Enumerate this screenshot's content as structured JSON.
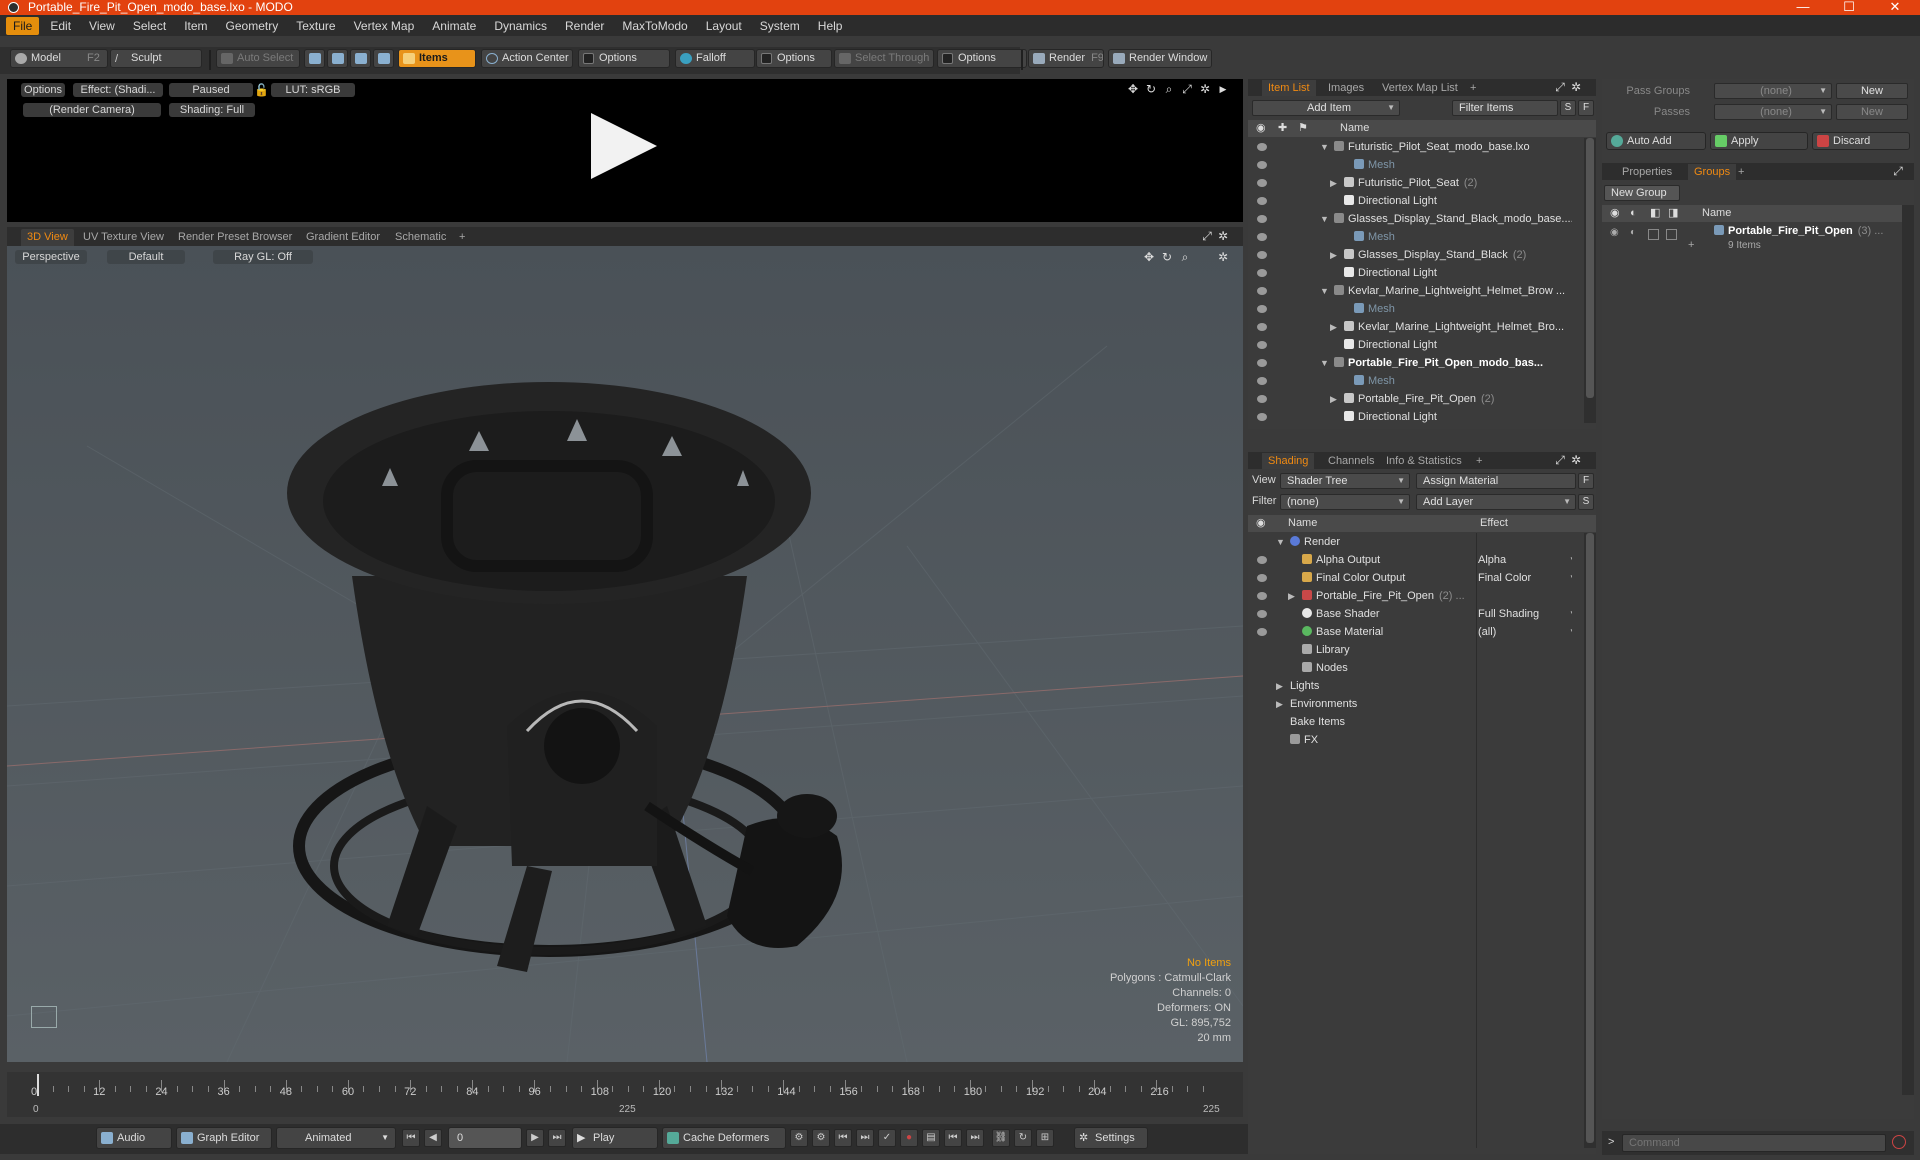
{
  "window": {
    "title": "Portable_Fire_Pit_Open_modo_base.lxo - MODO",
    "minimize": "—",
    "maximize": "☐",
    "close": "✕"
  },
  "menu": [
    "File",
    "Edit",
    "View",
    "Select",
    "Item",
    "Geometry",
    "Texture",
    "Vertex Map",
    "Animate",
    "Dynamics",
    "Render",
    "MaxToModo",
    "Layout",
    "System",
    "Help"
  ],
  "toolbar": {
    "model": "Model",
    "model_key": "F2",
    "sculpt": "Sculpt",
    "auto_select": "Auto Select",
    "items": "Items",
    "action_center": "Action Center",
    "options1": "Options",
    "falloff": "Falloff",
    "options2": "Options",
    "select_through": "Select Through",
    "options3": "Options",
    "render": "Render",
    "render_key": "F9",
    "render_window": "Render Window"
  },
  "preview": {
    "options": "Options",
    "effect": "Effect: (Shadi...",
    "paused": "Paused",
    "lut": "LUT: sRGB",
    "camera": "(Render Camera)",
    "shading": "Shading: Full"
  },
  "viewport_tabs": [
    "3D View",
    "UV Texture View",
    "Render Preset Browser",
    "Gradient Editor",
    "Schematic",
    "+"
  ],
  "viewport": {
    "perspective": "Perspective",
    "default": "Default",
    "raygl": "Ray GL: Off"
  },
  "stats": {
    "no_items": "No Items",
    "polygons": "Polygons : Catmull-Clark",
    "channels": "Channels: 0",
    "deformers": "Deformers: ON",
    "gl": "GL: 895,752",
    "scale": "20 mm"
  },
  "timeline": {
    "ticks": [
      "0",
      "12",
      "24",
      "36",
      "48",
      "60",
      "72",
      "84",
      "96",
      "108",
      "120",
      "132",
      "144",
      "156",
      "168",
      "180",
      "192",
      "204",
      "216"
    ],
    "start": "0",
    "mid": "225",
    "end": "225"
  },
  "transport": {
    "audio": "Audio",
    "graph_editor": "Graph Editor",
    "animated": "Animated",
    "frame": "0",
    "play": "Play",
    "cache_deformers": "Cache Deformers",
    "settings": "Settings"
  },
  "item_list": {
    "tabs": [
      "Item List",
      "Images",
      "Vertex Map List",
      "+"
    ],
    "add_item": "Add Item",
    "filter_items": "Filter Items",
    "s": "S",
    "f": "F",
    "col_name": "Name",
    "rows": [
      {
        "label": "Futuristic_Pilot_Seat_modo_base.lxo",
        "count": "",
        "indent": 0,
        "tri": "▼",
        "icon": "scene",
        "dim": false,
        "bold": false
      },
      {
        "label": "Mesh",
        "count": "",
        "indent": 2,
        "tri": "",
        "icon": "mesh",
        "dim": true,
        "bold": false
      },
      {
        "label": "Futuristic_Pilot_Seat",
        "count": "(2)",
        "indent": 1,
        "tri": "▶",
        "icon": "group",
        "dim": false,
        "bold": false
      },
      {
        "label": "Directional Light",
        "count": "",
        "indent": 1,
        "tri": "",
        "icon": "light",
        "dim": false,
        "bold": false
      },
      {
        "label": "Glasses_Display_Stand_Black_modo_base....",
        "count": "",
        "indent": 0,
        "tri": "▼",
        "icon": "scene",
        "dim": false,
        "bold": false
      },
      {
        "label": "Mesh",
        "count": "",
        "indent": 2,
        "tri": "",
        "icon": "mesh",
        "dim": true,
        "bold": false
      },
      {
        "label": "Glasses_Display_Stand_Black",
        "count": "(2)",
        "indent": 1,
        "tri": "▶",
        "icon": "group",
        "dim": false,
        "bold": false
      },
      {
        "label": "Directional Light",
        "count": "",
        "indent": 1,
        "tri": "",
        "icon": "light",
        "dim": false,
        "bold": false
      },
      {
        "label": "Kevlar_Marine_Lightweight_Helmet_Brow ...",
        "count": "",
        "indent": 0,
        "tri": "▼",
        "icon": "scene",
        "dim": false,
        "bold": false
      },
      {
        "label": "Mesh",
        "count": "",
        "indent": 2,
        "tri": "",
        "icon": "mesh",
        "dim": true,
        "bold": false
      },
      {
        "label": "Kevlar_Marine_Lightweight_Helmet_Bro...",
        "count": "",
        "indent": 1,
        "tri": "▶",
        "icon": "group",
        "dim": false,
        "bold": false
      },
      {
        "label": "Directional Light",
        "count": "",
        "indent": 1,
        "tri": "",
        "icon": "light",
        "dim": false,
        "bold": false
      },
      {
        "label": "Portable_Fire_Pit_Open_modo_bas...",
        "count": "",
        "indent": 0,
        "tri": "▼",
        "icon": "scene",
        "dim": false,
        "bold": true
      },
      {
        "label": "Mesh",
        "count": "",
        "indent": 2,
        "tri": "",
        "icon": "mesh",
        "dim": true,
        "bold": false
      },
      {
        "label": "Portable_Fire_Pit_Open",
        "count": "(2)",
        "indent": 1,
        "tri": "▶",
        "icon": "group",
        "dim": false,
        "bold": false
      },
      {
        "label": "Directional Light",
        "count": "",
        "indent": 1,
        "tri": "",
        "icon": "light",
        "dim": false,
        "bold": false
      }
    ]
  },
  "shading": {
    "tabs": [
      "Shading",
      "Channels",
      "Info & Statistics",
      "+"
    ],
    "view_label": "View",
    "view_value": "Shader Tree",
    "assign_material": "Assign Material",
    "filter_label": "Filter",
    "filter_value": "(none)",
    "add_layer": "Add Layer",
    "f": "F",
    "s": "S",
    "col_name": "Name",
    "col_effect": "Effect",
    "rows": [
      {
        "label": "Render",
        "effect": "",
        "indent": 0,
        "tri": "▼",
        "icon": "render",
        "eye": false
      },
      {
        "label": "Alpha Output",
        "effect": "Alpha",
        "indent": 1,
        "tri": "",
        "icon": "output",
        "eye": true
      },
      {
        "label": "Final Color Output",
        "effect": "Final Color",
        "indent": 1,
        "tri": "",
        "icon": "output",
        "eye": true
      },
      {
        "label": "Portable_Fire_Pit_Open",
        "count": "(2) ...",
        "effect": "",
        "indent": 1,
        "tri": "▶",
        "icon": "matgroup",
        "eye": true
      },
      {
        "label": "Base Shader",
        "effect": "Full Shading",
        "indent": 1,
        "tri": "",
        "icon": "shader",
        "eye": true
      },
      {
        "label": "Base Material",
        "effect": "(all)",
        "indent": 1,
        "tri": "",
        "icon": "material",
        "eye": true
      },
      {
        "label": "Library",
        "effect": "",
        "indent": 1,
        "tri": "",
        "icon": "folder",
        "eye": false
      },
      {
        "label": "Nodes",
        "effect": "",
        "indent": 1,
        "tri": "",
        "icon": "folder",
        "eye": false
      },
      {
        "label": "Lights",
        "effect": "",
        "indent": 0,
        "tri": "▶",
        "icon": "",
        "eye": false
      },
      {
        "label": "Environments",
        "effect": "",
        "indent": 0,
        "tri": "▶",
        "icon": "",
        "eye": false
      },
      {
        "label": "Bake Items",
        "effect": "",
        "indent": 0,
        "tri": "",
        "icon": "",
        "eye": false
      },
      {
        "label": "FX",
        "effect": "",
        "indent": 0,
        "tri": "",
        "icon": "fx",
        "eye": false
      }
    ]
  },
  "groups_panel": {
    "pass_groups_label": "Pass Groups",
    "pass_groups_value": "(none)",
    "passes_label": "Passes",
    "passes_value": "(none)",
    "new1": "New",
    "new2": "New",
    "auto_add": "Auto Add",
    "apply": "Apply",
    "discard": "Discard",
    "tabs": [
      "Properties",
      "Groups",
      "+"
    ],
    "new_group": "New Group",
    "col_name": "Name",
    "group_name": "Portable_Fire_Pit_Open",
    "group_count": "(3) ...",
    "group_items": "9 Items"
  },
  "command": {
    "placeholder": "Command",
    "prompt": ">"
  },
  "colors": {
    "accent": "#f08a12",
    "titlebar": "#e2420f",
    "highlight": "#e8931a"
  }
}
